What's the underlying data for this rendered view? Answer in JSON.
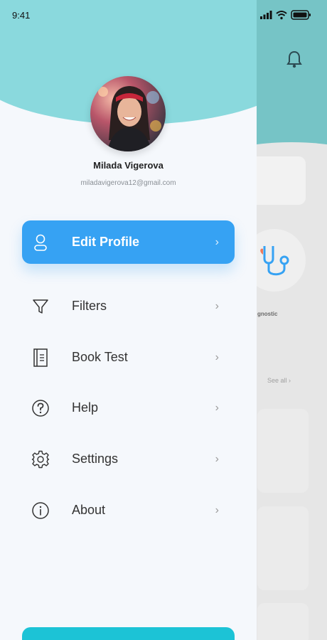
{
  "status_bar": {
    "time": "9:41"
  },
  "user": {
    "name": "Milada Vigerova",
    "email": "miladavigerova12@gmail.com"
  },
  "menu": [
    {
      "label": "Edit Profile",
      "icon": "user-icon",
      "active": true
    },
    {
      "label": "Filters",
      "icon": "filter-icon",
      "active": false
    },
    {
      "label": "Book Test",
      "icon": "book-icon",
      "active": false
    },
    {
      "label": "Help",
      "icon": "help-icon",
      "active": false
    },
    {
      "label": "Settings",
      "icon": "gear-icon",
      "active": false
    },
    {
      "label": "About",
      "icon": "info-icon",
      "active": false
    }
  ],
  "chevron": "›",
  "background_app": {
    "category_label": "gnostic",
    "see_all": "See all ›"
  },
  "colors": {
    "accent": "#36a2f3",
    "header_teal": "#8ad9dd",
    "bottom_button": "#1cc3d6"
  }
}
